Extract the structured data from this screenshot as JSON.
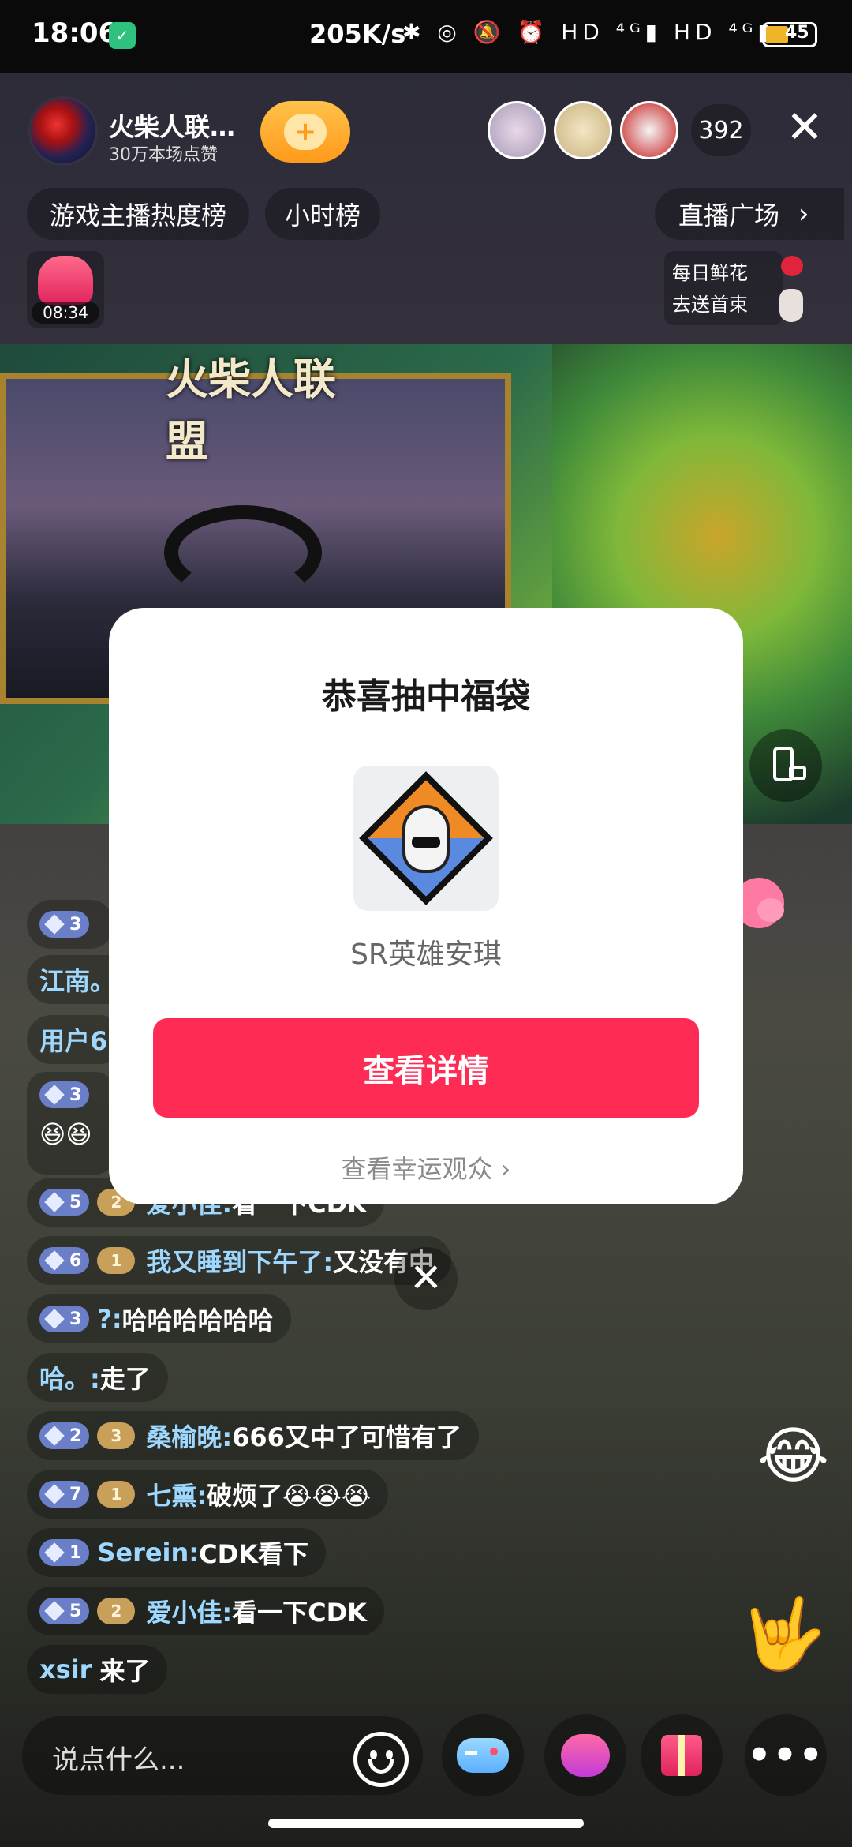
{
  "status_bar": {
    "time": "18:06",
    "network_speed": "205K/s",
    "icons_text": "✱ ◎ 🔕 ⏰ HD ⁴ᴳ▮ HD ⁴ᴳ▮",
    "battery": "45"
  },
  "header": {
    "anchor_name": "火柴人联…",
    "likes": "30万本场点赞",
    "follow_icon": "+",
    "viewer_count": "392",
    "close_icon": "✕"
  },
  "pills": {
    "rank": "游戏主播热度榜",
    "hourly": "小时榜",
    "plaza": "直播广场",
    "plaza_chevron": "›"
  },
  "gift_bag": {
    "timer": "08:34"
  },
  "flower": {
    "line1": "每日鲜花",
    "line2": "去送首束"
  },
  "video": {
    "logo_text": "火柴人联盟"
  },
  "chat": [
    {
      "level": "3",
      "fan": "",
      "user": "江南。",
      "text": ""
    },
    {
      "level": "",
      "fan": "",
      "user": "用户6",
      "text": ""
    },
    {
      "level": "3",
      "fan": "",
      "user": "",
      "text": "😆😆"
    },
    {
      "level": "5",
      "fan": "2",
      "user": "爱小佳:",
      "text": "看一下CDK"
    },
    {
      "level": "6",
      "fan": "1",
      "user": "我又睡到下午了:",
      "text": "又没有中"
    },
    {
      "level": "3",
      "fan": "",
      "user": "?:",
      "text": "哈哈哈哈哈哈"
    },
    {
      "level": "",
      "fan": "",
      "user": "哈。:",
      "text": "走了"
    },
    {
      "level": "2",
      "fan": "3",
      "user": "桑榆晚:",
      "text": "666又中了可惜有了"
    },
    {
      "level": "7",
      "fan": "1",
      "user": "七熏:",
      "text": "破烦了😭😭😭"
    },
    {
      "level": "1",
      "fan": "",
      "user": "Serein:",
      "text": "CDK看下"
    },
    {
      "level": "5",
      "fan": "2",
      "user": "爱小佳:",
      "text": "看一下CDK"
    },
    {
      "level": "",
      "fan": "",
      "user": "xsir",
      "text": "来了"
    }
  ],
  "popup": {
    "title": "恭喜抽中福袋",
    "item_name": "SR英雄安琪",
    "button": "查看详情",
    "link": "查看幸运观众 ›",
    "close_icon": "✕"
  },
  "bottom": {
    "input_placeholder": "说点什么...",
    "more_icon": "•••"
  }
}
